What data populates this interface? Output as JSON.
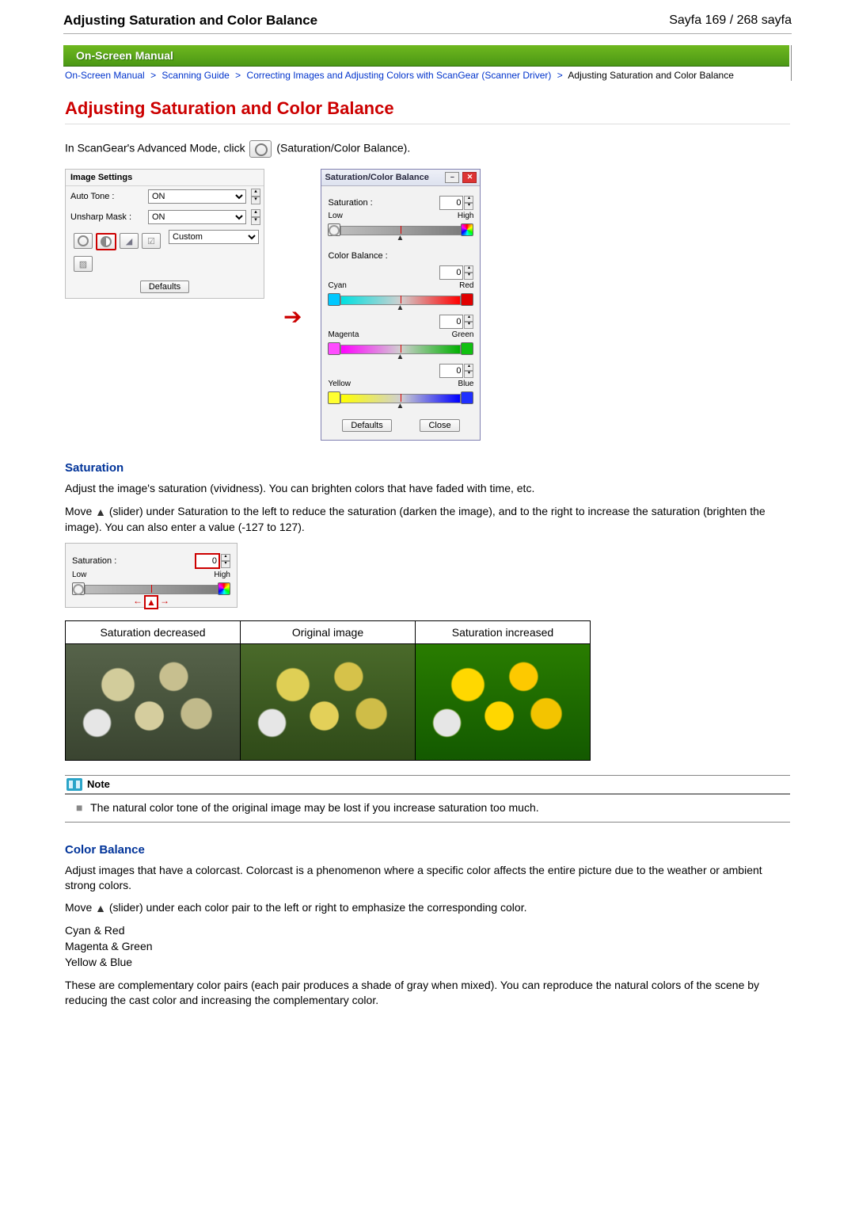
{
  "header": {
    "title": "Adjusting Saturation and Color Balance",
    "paging": "Sayfa 169 / 268 sayfa"
  },
  "banner": {
    "title": "On-Screen Manual"
  },
  "breadcrumb": {
    "items": [
      "On-Screen Manual",
      "Scanning Guide",
      "Correcting Images and Adjusting Colors with ScanGear (Scanner Driver)"
    ],
    "current": "Adjusting Saturation and Color Balance"
  },
  "page_title": "Adjusting Saturation and Color Balance",
  "intro": {
    "pre": "In ScanGear's Advanced Mode, click ",
    "post": " (Saturation/Color Balance)."
  },
  "image_settings": {
    "panel_title": "Image Settings",
    "rows": {
      "auto_tone_label": "Auto Tone :",
      "auto_tone_value": "ON",
      "unsharp_label": "Unsharp Mask :",
      "unsharp_value": "ON"
    },
    "custom_value": "Custom",
    "defaults_btn": "Defaults"
  },
  "dialog": {
    "title": "Saturation/Color Balance",
    "saturation_label": "Saturation :",
    "saturation_value": "0",
    "low": "Low",
    "high": "High",
    "color_balance_label": "Color Balance :",
    "cr": {
      "value": "0",
      "left": "Cyan",
      "right": "Red"
    },
    "mg": {
      "value": "0",
      "left": "Magenta",
      "right": "Green"
    },
    "yb": {
      "value": "0",
      "left": "Yellow",
      "right": "Blue"
    },
    "defaults_btn": "Defaults",
    "close_btn": "Close"
  },
  "sections": {
    "saturation": {
      "heading": "Saturation",
      "p1": "Adjust the image's saturation (vividness). You can brighten colors that have faded with time, etc.",
      "p2a": "Move ",
      "p2b": " (slider) under Saturation to the left to reduce the saturation (darken the image), and to the right to increase the saturation (brighten the image). You can also enter a value (-127 to 127).",
      "ill": {
        "label": "Saturation :",
        "value": "0",
        "low": "Low",
        "high": "High"
      },
      "table": {
        "h1": "Saturation decreased",
        "h2": "Original image",
        "h3": "Saturation increased"
      },
      "note_title": "Note",
      "note_text": "The natural color tone of the original image may be lost if you increase saturation too much."
    },
    "color_balance": {
      "heading": "Color Balance",
      "p1": "Adjust images that have a colorcast. Colorcast is a phenomenon where a specific color affects the entire picture due to the weather or ambient strong colors.",
      "p2a": "Move ",
      "p2b": " (slider) under each color pair to the left or right to emphasize the corresponding color.",
      "pairs": [
        "Cyan & Red",
        "Magenta & Green",
        "Yellow & Blue"
      ],
      "p3": "These are complementary color pairs (each pair produces a shade of gray when mixed). You can reproduce the natural colors of the scene by reducing the cast color and increasing the complementary color."
    }
  }
}
